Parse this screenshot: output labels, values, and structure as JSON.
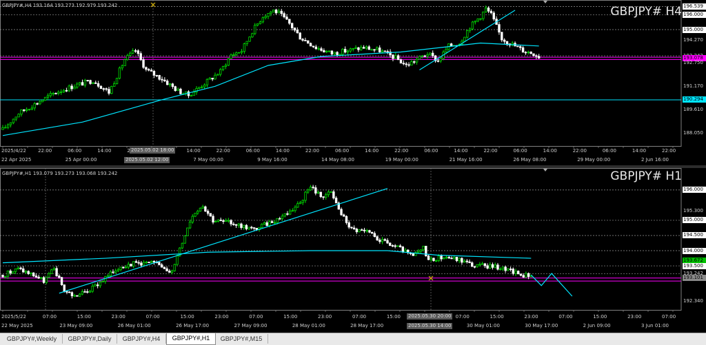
{
  "colors": {
    "up": "#00e000",
    "down": "#ffffff",
    "ma": "#00e5ff",
    "magenta": "#ff00ff",
    "grid": "#5a5a5a"
  },
  "panes": [
    {
      "id": "h4",
      "info": "GBPJPY#,H4  193.164 193.273 192.979 193.242",
      "title": "GBPJPY# H4",
      "price_min": 187.2,
      "price_max": 196.8,
      "prices": [
        {
          "value": 196.539,
          "text": "196.539",
          "style": "white"
        },
        {
          "value": 196.0,
          "text": "196.000",
          "style": "white"
        },
        {
          "value": 195.0,
          "text": "195.000",
          "style": "white"
        },
        {
          "value": 194.27,
          "text": "194.270",
          "style": "plain"
        },
        {
          "value": 193.242,
          "text": "193.242",
          "style": "plain"
        },
        {
          "value": 193.078,
          "text": "193.078",
          "style": "magenta"
        },
        {
          "value": 192.75,
          "text": "192.750",
          "style": "plain"
        },
        {
          "value": 191.17,
          "text": "191.170",
          "style": "plain"
        },
        {
          "value": 190.294,
          "text": "190.294",
          "style": "cyan"
        },
        {
          "value": 189.61,
          "text": "189.610",
          "style": "plain"
        },
        {
          "value": 188.05,
          "text": "188.050",
          "style": "plain"
        }
      ],
      "hlines": [
        {
          "value": 196.539,
          "kind": "dotted"
        },
        {
          "value": 196.0,
          "kind": "dotted"
        },
        {
          "value": 195.0,
          "kind": "dotted"
        },
        {
          "value": 193.242,
          "kind": "dotted"
        },
        {
          "value": 193.15,
          "kind": "magenta"
        },
        {
          "value": 193.0,
          "kind": "magenta"
        },
        {
          "value": 190.294,
          "kind": "cyan"
        }
      ],
      "time_row1": [
        "2025/4/22",
        "22:00",
        "06:00",
        "14:00",
        "22:00",
        "06:00",
        "14:00",
        "22:00",
        "06:00",
        "14:00",
        "22:00",
        "06:00",
        "14:00",
        "22:00",
        "06:00",
        "14:00",
        "22:00",
        "06:00",
        "14:00",
        "22:00",
        "06:00",
        "14:00",
        "22:00"
      ],
      "time_row2": [
        "22 Apr 2025",
        "25 Apr 00:00",
        "29 Apr 16:00",
        "7 May 00:00",
        "9 May 16:00",
        "14 May 08:00",
        "19 May 00:00",
        "21 May 16:00",
        "26 May 08:00",
        "29 May 00:00",
        "2 Jun 16:00"
      ],
      "cursor_time1": "2025.05.02 18:00",
      "cursor_time2": "2025.05.02 12:00",
      "waypoints": [
        [
          0,
          188.3
        ],
        [
          6,
          189.4
        ],
        [
          12,
          190.0
        ],
        [
          20,
          190.8
        ],
        [
          28,
          191.3
        ],
        [
          34,
          191.6
        ],
        [
          40,
          190.8
        ],
        [
          46,
          193.0
        ],
        [
          50,
          193.6
        ],
        [
          54,
          192.3
        ],
        [
          60,
          191.7
        ],
        [
          66,
          190.9
        ],
        [
          70,
          190.6
        ],
        [
          76,
          191.4
        ],
        [
          82,
          192.2
        ],
        [
          86,
          193.3
        ],
        [
          90,
          193.6
        ],
        [
          94,
          194.9
        ],
        [
          98,
          195.9
        ],
        [
          102,
          196.3
        ],
        [
          104,
          196.1
        ],
        [
          108,
          195.4
        ],
        [
          112,
          194.5
        ],
        [
          118,
          193.8
        ],
        [
          124,
          193.4
        ],
        [
          130,
          193.6
        ],
        [
          136,
          193.8
        ],
        [
          142,
          193.6
        ],
        [
          148,
          193.1
        ],
        [
          152,
          192.6
        ],
        [
          156,
          193.0
        ],
        [
          160,
          193.4
        ],
        [
          164,
          192.9
        ],
        [
          168,
          193.9
        ],
        [
          172,
          194.1
        ],
        [
          176,
          195.2
        ],
        [
          180,
          195.9
        ],
        [
          182,
          196.4
        ],
        [
          184,
          196.0
        ],
        [
          188,
          194.4
        ],
        [
          192,
          194.0
        ],
        [
          196,
          193.6
        ],
        [
          200,
          193.4
        ],
        [
          202,
          193.2
        ]
      ],
      "ma": [
        [
          0,
          187.9
        ],
        [
          30,
          188.8
        ],
        [
          60,
          190.3
        ],
        [
          80,
          191.2
        ],
        [
          100,
          192.6
        ],
        [
          120,
          193.2
        ],
        [
          150,
          193.5
        ],
        [
          165,
          193.8
        ],
        [
          180,
          194.1
        ],
        [
          202,
          193.9
        ]
      ],
      "trendlines": [
        [
          157,
          192.3,
          193,
          196.3
        ]
      ]
    },
    {
      "id": "h1",
      "info": "GBPJPY#,H1  193.079 193.273 193.068 193.242",
      "title": "GBPJPY# H1",
      "price_min": 192.05,
      "price_max": 196.45,
      "prices": [
        {
          "value": 196.0,
          "text": "196.000",
          "style": "white"
        },
        {
          "value": 195.3,
          "text": "195.300",
          "style": "plain"
        },
        {
          "value": 195.0,
          "text": "195.000",
          "style": "white"
        },
        {
          "value": 194.5,
          "text": "194.500",
          "style": "white"
        },
        {
          "value": 194.0,
          "text": "194.000",
          "style": "white"
        },
        {
          "value": 193.672,
          "text": "193.672",
          "style": "green"
        },
        {
          "value": 193.5,
          "text": "193.500",
          "style": "white"
        },
        {
          "value": 193.242,
          "text": "193.242",
          "style": "plain"
        },
        {
          "value": 193.101,
          "text": "193.101",
          "style": "gray"
        },
        {
          "value": 192.34,
          "text": "192.340",
          "style": "plain"
        }
      ],
      "hlines": [
        {
          "value": 196.0,
          "kind": "dotted"
        },
        {
          "value": 195.0,
          "kind": "dotted"
        },
        {
          "value": 194.5,
          "kind": "dotted"
        },
        {
          "value": 194.0,
          "kind": "dotted"
        },
        {
          "value": 193.5,
          "kind": "dotted"
        },
        {
          "value": 193.242,
          "kind": "dotted"
        },
        {
          "value": 193.1,
          "kind": "magenta"
        },
        {
          "value": 193.0,
          "kind": "magenta"
        }
      ],
      "time_row1": [
        "2025/5/22",
        "07:00",
        "15:00",
        "23:00",
        "07:00",
        "15:00",
        "23:00",
        "07:00",
        "15:00",
        "23:00",
        "07:00",
        "15:00",
        "23:00",
        "07:00",
        "15:00",
        "23:00",
        "07:00",
        "15:00",
        "23:00",
        "07:00"
      ],
      "time_row2": [
        "22 May 2025",
        "23 May 09:00",
        "26 May 01:00",
        "26 May 17:00",
        "27 May 09:00",
        "28 May 01:00",
        "28 May 17:00",
        "29 May 09:00",
        "30 May 01:00",
        "30 May 17:00",
        "2 Jun 09:00",
        "3 Jun 01:00"
      ],
      "cursor_time1": "2025.05.30 20:00",
      "cursor_time2": "2025.05.30 14:00",
      "waypoints": [
        [
          0,
          193.2
        ],
        [
          6,
          193.4
        ],
        [
          12,
          193.2
        ],
        [
          16,
          193.0
        ],
        [
          20,
          193.4
        ],
        [
          24,
          192.7
        ],
        [
          28,
          192.5
        ],
        [
          34,
          192.7
        ],
        [
          40,
          193.1
        ],
        [
          46,
          193.5
        ],
        [
          52,
          193.6
        ],
        [
          58,
          193.6
        ],
        [
          62,
          193.5
        ],
        [
          66,
          193.3
        ],
        [
          70,
          194.3
        ],
        [
          74,
          195.2
        ],
        [
          78,
          195.5
        ],
        [
          82,
          195.0
        ],
        [
          90,
          194.9
        ],
        [
          98,
          194.7
        ],
        [
          106,
          195.0
        ],
        [
          112,
          195.3
        ],
        [
          116,
          195.6
        ],
        [
          120,
          196.1
        ],
        [
          124,
          195.8
        ],
        [
          128,
          195.9
        ],
        [
          132,
          195.2
        ],
        [
          136,
          194.7
        ],
        [
          142,
          194.6
        ],
        [
          148,
          194.3
        ],
        [
          154,
          194.1
        ],
        [
          160,
          193.8
        ],
        [
          164,
          194.1
        ],
        [
          166,
          193.7
        ],
        [
          172,
          193.8
        ],
        [
          178,
          193.7
        ],
        [
          184,
          193.5
        ],
        [
          190,
          193.5
        ],
        [
          196,
          193.4
        ],
        [
          202,
          193.2
        ],
        [
          206,
          193.2
        ]
      ],
      "ma": [
        [
          0,
          193.6
        ],
        [
          40,
          193.75
        ],
        [
          80,
          193.95
        ],
        [
          120,
          194.0
        ],
        [
          150,
          194.0
        ],
        [
          170,
          193.85
        ],
        [
          206,
          193.75
        ]
      ],
      "trendlines": [
        [
          22,
          192.6,
          150,
          196.05
        ]
      ],
      "forecast": [
        [
          206,
          193.2
        ],
        [
          210,
          192.85
        ],
        [
          214,
          193.25
        ],
        [
          222,
          192.5
        ]
      ]
    }
  ],
  "tabs": [
    {
      "label": "GBPJPY#,Weekly",
      "active": false
    },
    {
      "label": "GBPJPY#,Daily",
      "active": false
    },
    {
      "label": "GBPJPY#,H4",
      "active": false
    },
    {
      "label": "GBPJPY#,H1",
      "active": true
    },
    {
      "label": "GBPJPY#,M15",
      "active": false
    }
  ]
}
